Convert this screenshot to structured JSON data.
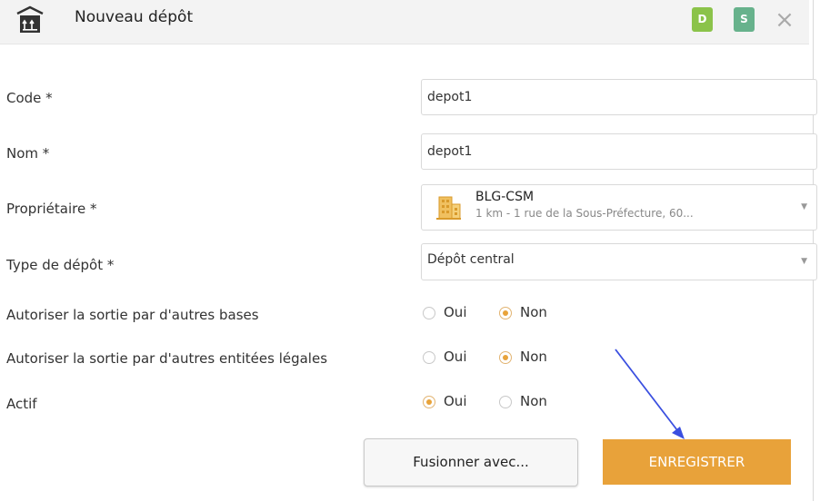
{
  "header": {
    "title": "Nouveau dépôt",
    "badges": [
      {
        "label": "D",
        "color": "#8bc34a"
      },
      {
        "label": "S",
        "color": "#67b28c"
      }
    ],
    "close_icon": "close-icon",
    "close_glyph": "×"
  },
  "form": {
    "code": {
      "label": "Code *",
      "value": "depot1"
    },
    "nom": {
      "label": "Nom *",
      "value": "depot1"
    },
    "proprietaire": {
      "label": "Propriétaire *",
      "name": "BLG-CSM",
      "address": "1 km - 1 rue de la Sous-Préfecture, 60..."
    },
    "type": {
      "label": "Type de dépôt *",
      "value": "Dépôt central"
    },
    "sortie_bases": {
      "label": "Autoriser la sortie par d'autres bases",
      "oui": "Oui",
      "non": "Non",
      "selected": "Non"
    },
    "sortie_entites": {
      "label": "Autoriser la sortie par d'autres entitées légales",
      "oui": "Oui",
      "non": "Non",
      "selected": "Non"
    },
    "actif": {
      "label": "Actif",
      "oui": "Oui",
      "non": "Non",
      "selected": "Oui"
    }
  },
  "buttons": {
    "merge": "Fusionner avec...",
    "save": "ENREGISTRER"
  },
  "colors": {
    "accent": "#e8a23a",
    "annotation_arrow": "#3a4fe0"
  }
}
